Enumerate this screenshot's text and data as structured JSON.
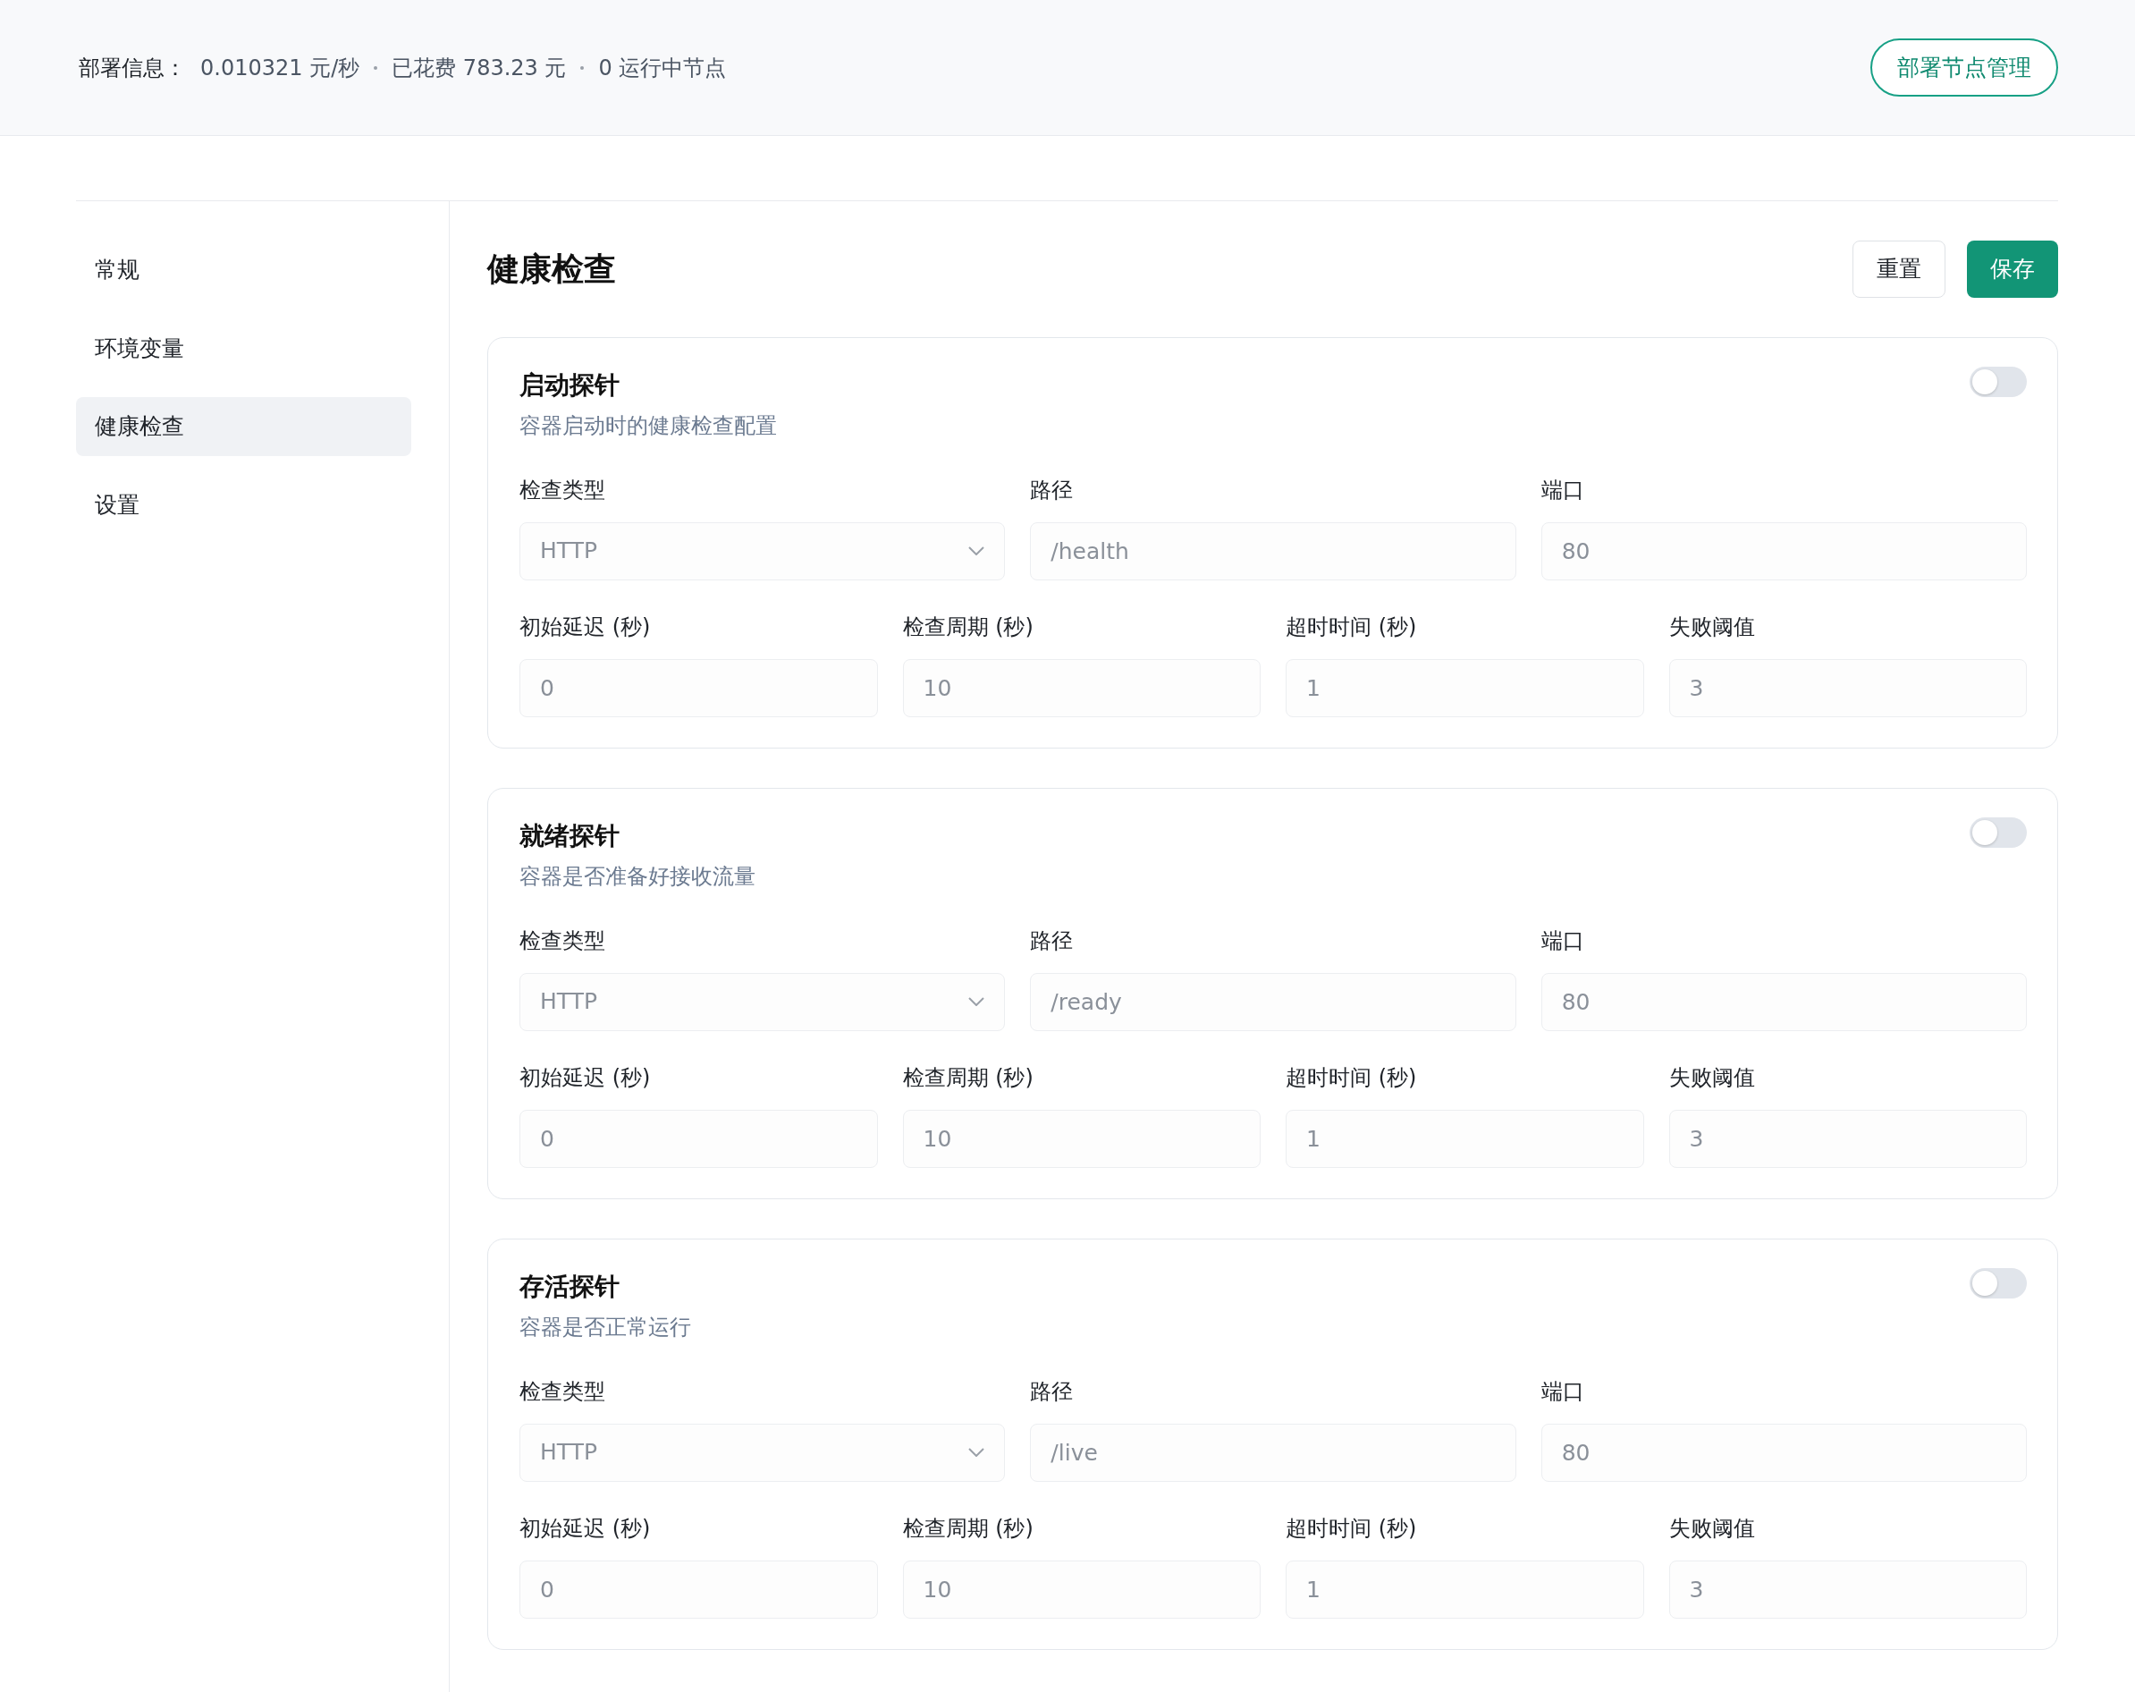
{
  "header": {
    "label": "部署信息：",
    "items": [
      "0.010321 元/秒",
      "已花费 783.23 元",
      "0 运行中节点"
    ],
    "button": "部署节点管理"
  },
  "sidebar": {
    "items": [
      {
        "label": "常规",
        "selected": false
      },
      {
        "label": "环境变量",
        "selected": false
      },
      {
        "label": "健康检查",
        "selected": true
      },
      {
        "label": "设置",
        "selected": false
      }
    ]
  },
  "page": {
    "title": "健康检查",
    "buttons": [
      {
        "label": "重置",
        "kind": "outline"
      },
      {
        "label": "保存",
        "kind": "primary"
      }
    ]
  },
  "probes": [
    {
      "title": "启动探针",
      "subtitle": "容器启动时的健康检查配置",
      "on": false,
      "fields": [
        {
          "label": "检查类型",
          "value": "HTTP",
          "kind": "select"
        },
        {
          "label": "路径",
          "value": "/health",
          "kind": "input"
        },
        {
          "label": "端口",
          "value": "80",
          "kind": "input"
        }
      ],
      "timings": [
        {
          "label": "初始延迟 (秒)",
          "value": "0"
        },
        {
          "label": "检查周期 (秒)",
          "value": "10"
        },
        {
          "label": "超时时间 (秒)",
          "value": "1"
        },
        {
          "label": "失败阈值",
          "value": "3"
        }
      ]
    },
    {
      "title": "就绪探针",
      "subtitle": "容器是否准备好接收流量",
      "on": false,
      "fields": [
        {
          "label": "检查类型",
          "value": "HTTP",
          "kind": "select"
        },
        {
          "label": "路径",
          "value": "/ready",
          "kind": "input"
        },
        {
          "label": "端口",
          "value": "80",
          "kind": "input"
        }
      ],
      "timings": [
        {
          "label": "初始延迟 (秒)",
          "value": "0"
        },
        {
          "label": "检查周期 (秒)",
          "value": "10"
        },
        {
          "label": "超时时间 (秒)",
          "value": "1"
        },
        {
          "label": "失败阈值",
          "value": "3"
        }
      ]
    },
    {
      "title": "存活探针",
      "subtitle": "容器是否正常运行",
      "on": false,
      "fields": [
        {
          "label": "检查类型",
          "value": "HTTP",
          "kind": "select"
        },
        {
          "label": "路径",
          "value": "/live",
          "kind": "input"
        },
        {
          "label": "端口",
          "value": "80",
          "kind": "input"
        }
      ],
      "timings": [
        {
          "label": "初始延迟 (秒)",
          "value": "0"
        },
        {
          "label": "检查周期 (秒)",
          "value": "10"
        },
        {
          "label": "超时时间 (秒)",
          "value": "1"
        },
        {
          "label": "失败阈值",
          "value": "3"
        }
      ]
    }
  ]
}
